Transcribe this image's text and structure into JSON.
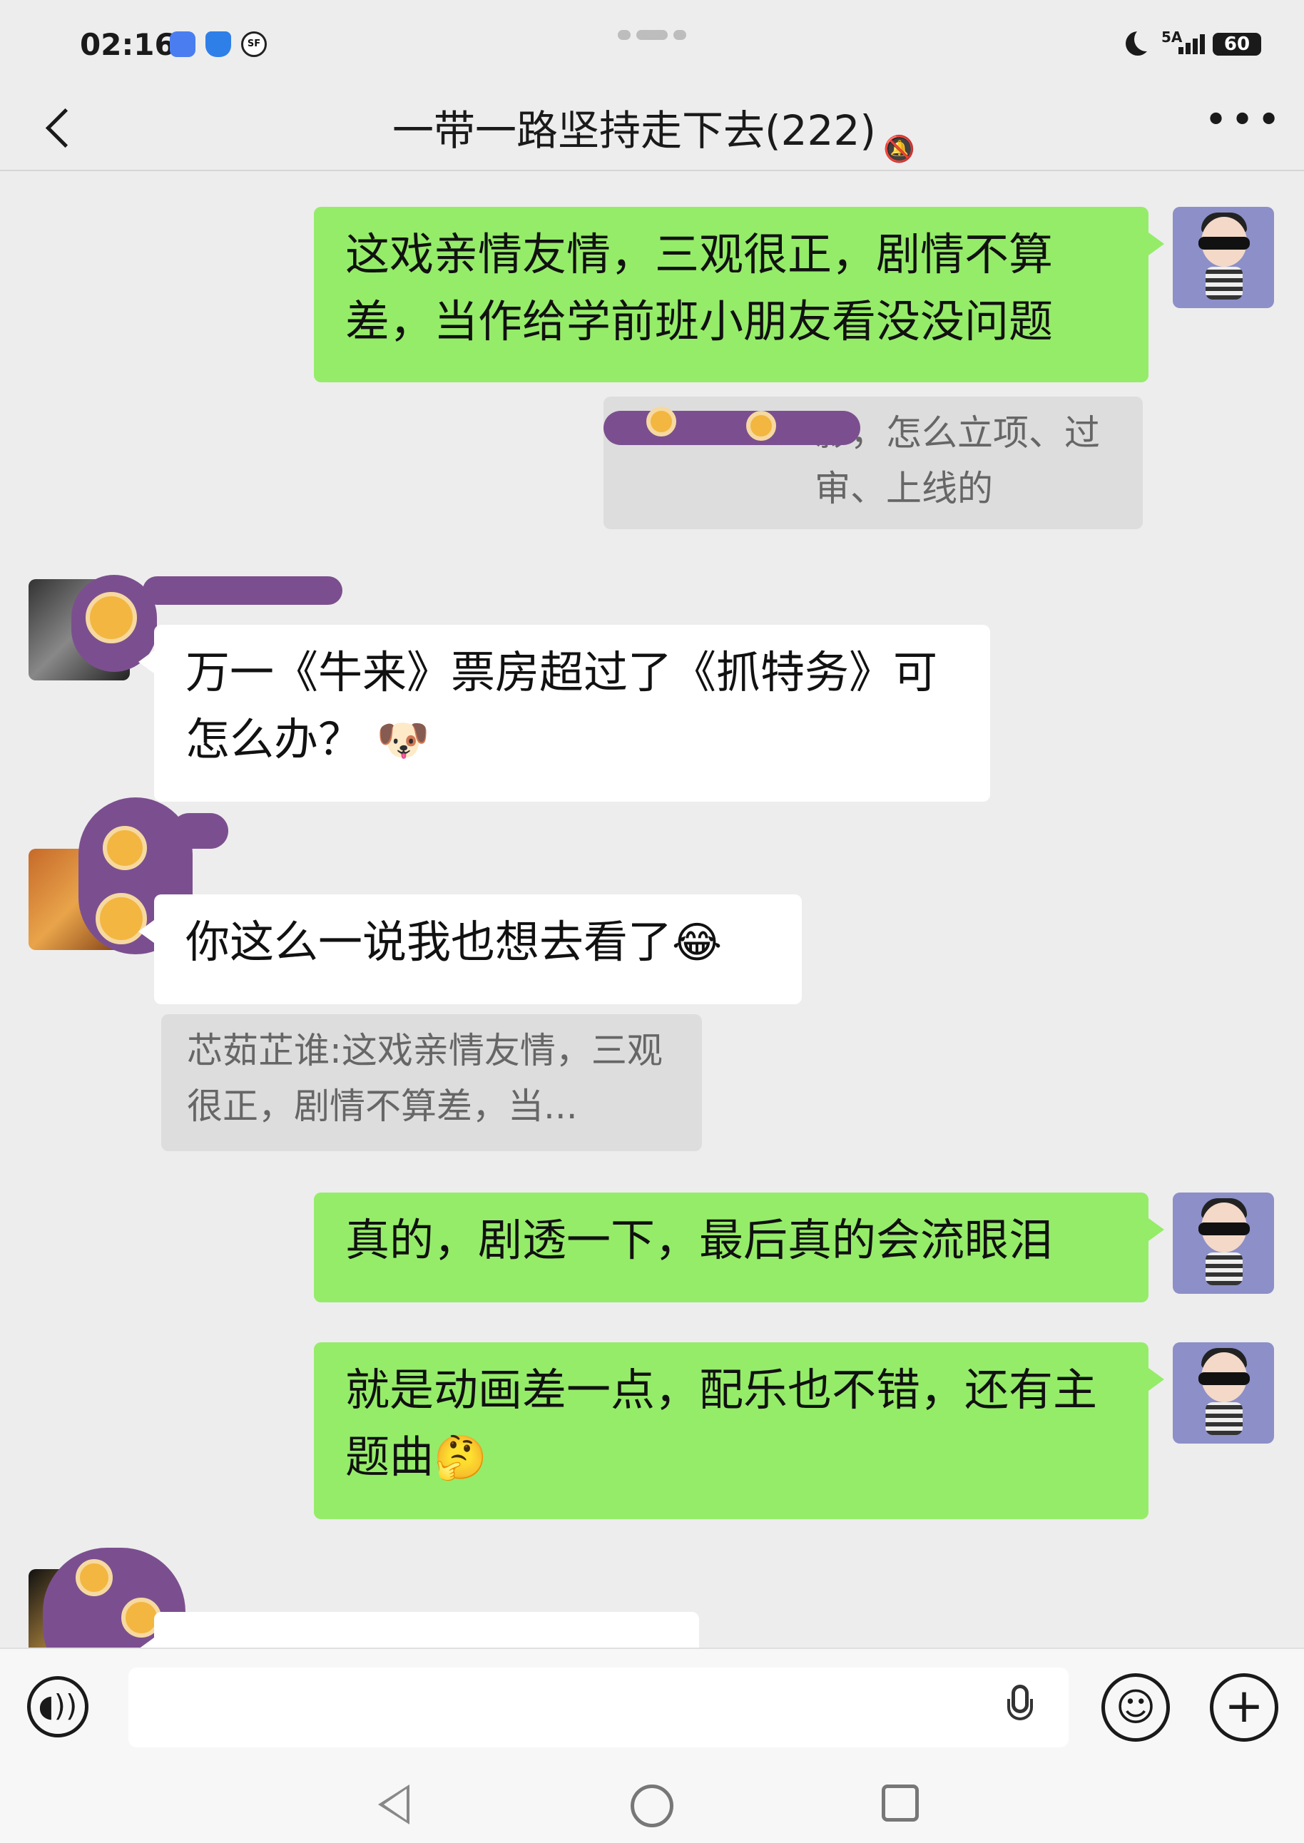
{
  "status_bar": {
    "time": "02:16",
    "network": "5A",
    "battery": "60"
  },
  "header": {
    "title": "一带一路坚持走下去(222)",
    "muted_icon": "bell-off-icon",
    "more_icon": "more-icon"
  },
  "messages": [
    {
      "side": "me",
      "text": "这戏亲情友情，三观很正，剧情不算差，当作给学前班小朋友看没没问题"
    },
    {
      "side": "me",
      "quote": "影，怎么立项、过审、上线的"
    },
    {
      "side": "other",
      "text": "万一《牛来》票房超过了《抓特务》可怎么办？",
      "emoji": "dog-face-emoji"
    },
    {
      "side": "other",
      "text": "你这么一说我也想去看了",
      "emoji": "laughing-crying-emoji"
    },
    {
      "side": "other",
      "quote": "芯茹芷谁:这戏亲情友情，三观很正，剧情不算差，当..."
    },
    {
      "side": "me",
      "text": "真的，剧透一下，最后真的会流眼泪"
    },
    {
      "side": "me",
      "text": "就是动画差一点，配乐也不错，还有主题曲",
      "emoji": "thinking-emoji"
    }
  ],
  "input_bar": {
    "value": "",
    "voice_icon": "voice-icon",
    "mic_icon": "microphone-icon",
    "emoji_icon": "emoji-icon",
    "plus_icon": "plus-icon"
  },
  "colors": {
    "background": "#ededed",
    "my_bubble": "#95ec69",
    "other_bubble": "#ffffff",
    "quote_bg": "#dddddd"
  }
}
